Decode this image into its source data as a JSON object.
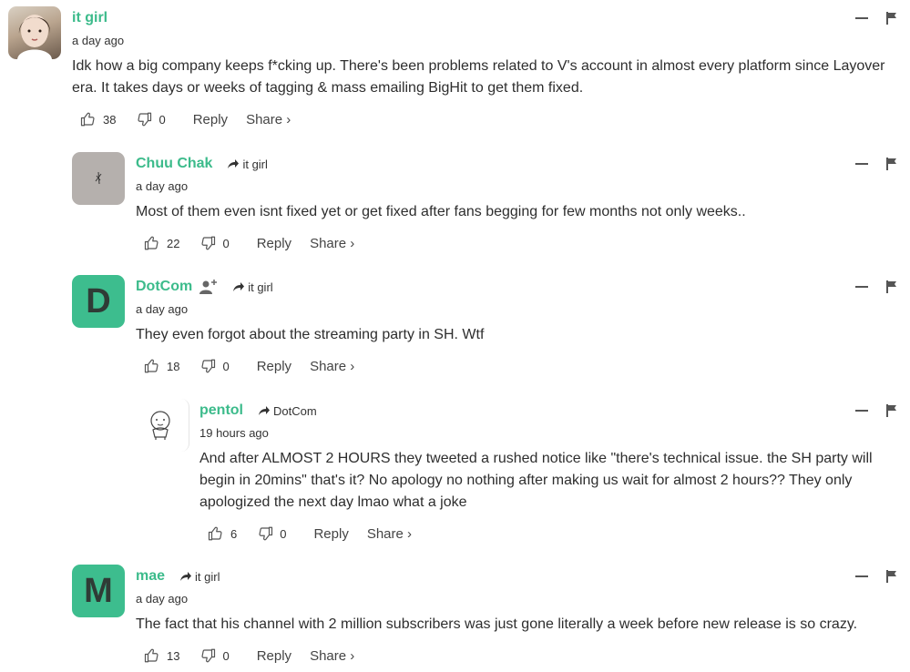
{
  "actions": {
    "reply_label": "Reply",
    "share_label": "Share ›"
  },
  "comments": [
    {
      "author": "it girl",
      "reply_to": "",
      "time": "a day ago",
      "text": "Idk how a big company keeps f*cking up. There's been problems related to V's account in almost every platform since Layover era. It takes days or weeks of tagging & mass emailing BigHit to get them fixed.",
      "upvotes": "38",
      "downvotes": "0",
      "avatar": "photo"
    },
    {
      "author": "Chuu Chak",
      "reply_to": "it girl",
      "time": "a day ago",
      "text": "Most of them even isnt fixed yet or get fixed after fans begging for few months not only weeks..",
      "upvotes": "22",
      "downvotes": "0",
      "avatar": "grey"
    },
    {
      "author": "DotCom",
      "reply_to": "it girl",
      "time": "a day ago",
      "text": "They even forgot about the streaming party in SH. Wtf",
      "upvotes": "18",
      "downvotes": "0",
      "avatar": "D"
    },
    {
      "author": "pentol",
      "reply_to": "DotCom",
      "time": "19 hours ago",
      "text": "And after ALMOST 2 HOURS they tweeted a rushed notice like \"there's technical issue. the SH party will begin in 20mins\" that's it? No apology no nothing after making us wait for almost 2 hours?? They only apologized the next day lmao what a joke",
      "upvotes": "6",
      "downvotes": "0",
      "avatar": "sketch"
    },
    {
      "author": "mae",
      "reply_to": "it girl",
      "time": "a day ago",
      "text": "The fact that his channel with 2 million subscribers was just gone literally a week before new release is so crazy.",
      "upvotes": "13",
      "downvotes": "0",
      "avatar": "M"
    }
  ],
  "colors": {
    "accent": "#3cbb8b",
    "avatar_green": "#3dbd8e"
  }
}
